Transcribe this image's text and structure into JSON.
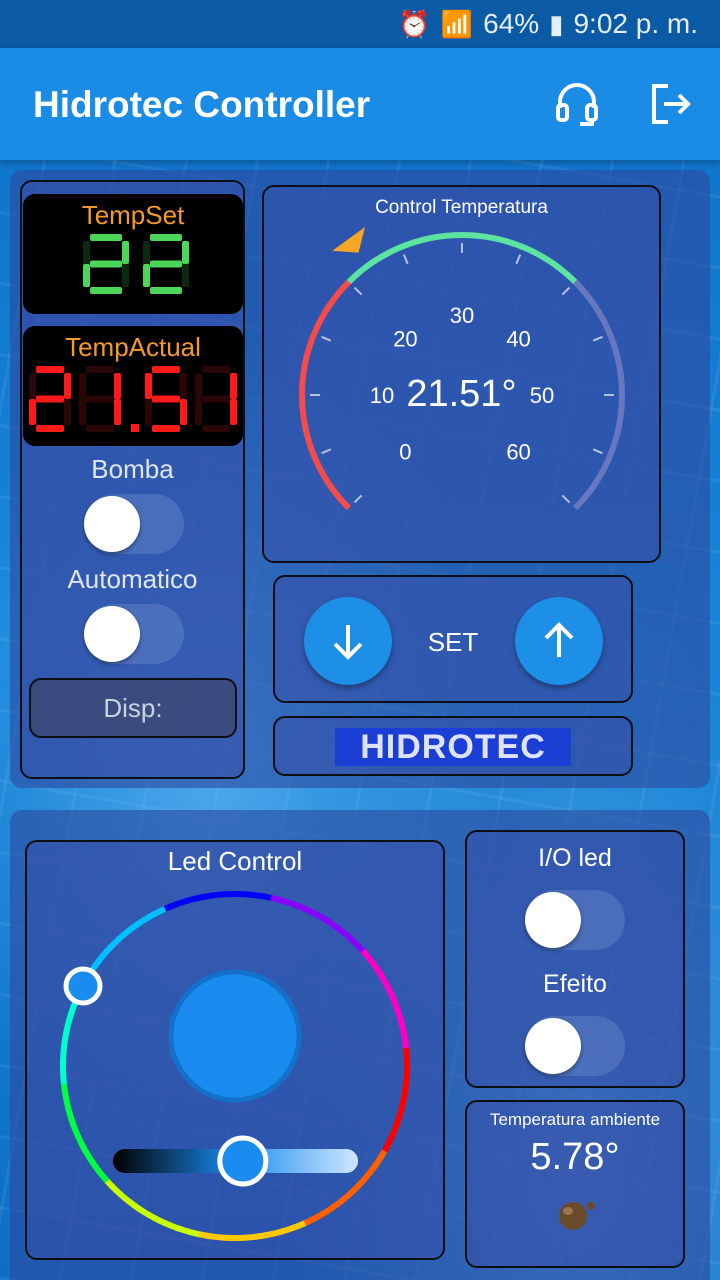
{
  "status": {
    "battery": "64%",
    "time": "9:02 p. m."
  },
  "header": {
    "title": "Hidrotec Controller",
    "support_icon": "headset-icon",
    "logout_icon": "logout-icon"
  },
  "controls": {
    "tempset_label": "TempSet",
    "tempset_value": "22",
    "tempactual_label": "TempActual",
    "tempactual_value": "21.51",
    "bomba_label": "Bomba",
    "bomba_on": false,
    "automatico_label": "Automatico",
    "automatico_on": false,
    "disp_label": "Disp:"
  },
  "gauge": {
    "title": "Control Temperatura",
    "value": "21.51°",
    "min": 0,
    "max": 60,
    "ticks": [
      "0",
      "10",
      "20",
      "30",
      "40",
      "50",
      "60"
    ],
    "setpoint": 22,
    "colors": {
      "red": "#f44b4b",
      "green": "#5de3a0",
      "gray": "#6878c0",
      "marker": "#f5a623"
    }
  },
  "set_panel": {
    "label": "SET",
    "down_icon": "arrow-down-icon",
    "up_icon": "arrow-up-icon"
  },
  "brand": {
    "text": "HIDROTEC"
  },
  "led": {
    "title": "Led Control",
    "color": "#1a8cf0",
    "brightness_percent": 53
  },
  "io_led": {
    "label": "I/O led",
    "on": false
  },
  "efeito": {
    "label": "Efeito",
    "on": false
  },
  "ambient": {
    "label": "Temperatura ambiente",
    "value": "5.78°"
  }
}
